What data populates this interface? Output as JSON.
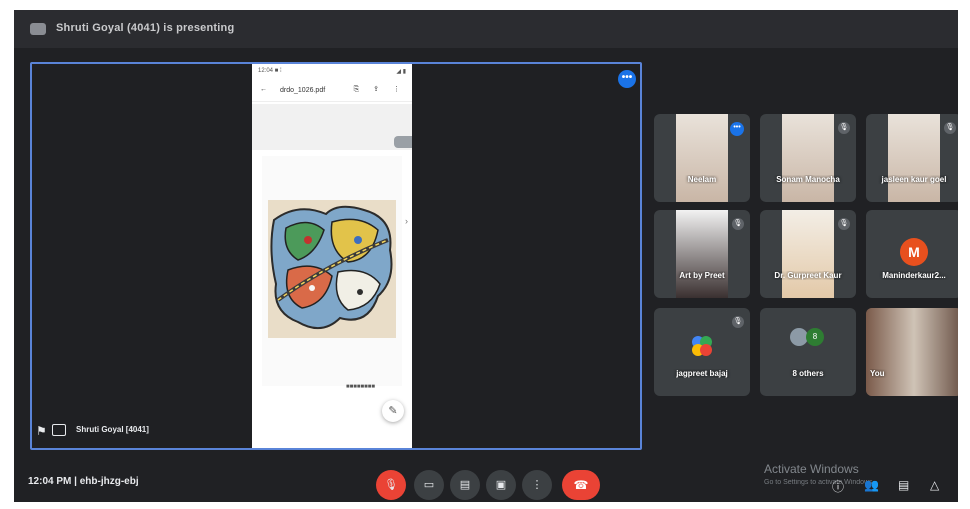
{
  "topbar": {
    "title": "Shruti Goyal (4041) is presenting"
  },
  "stage": {
    "presenter_name": "Shruti Goyal [4041]",
    "more_label": "•••",
    "phone": {
      "time": "12:04 ■ ⁞",
      "signal": "◢ ▮",
      "back": "←",
      "filename": "drdo_1026.pdf",
      "tools": "⎘ ⇪ ⋮",
      "chevron": "›",
      "page_foot": "■■■■■■■■",
      "fab": "✎"
    }
  },
  "participants": [
    {
      "name": "Neelam",
      "badge": "•••"
    },
    {
      "name": "Sonam Manocha",
      "badge": "🎙"
    },
    {
      "name": "jasleen kaur goel",
      "badge": "🎙"
    },
    {
      "name": "Art by Preet",
      "badge": "🎙"
    },
    {
      "name": "Dr. Gurpreet Kaur",
      "badge": "🎙"
    },
    {
      "name": "Maninderkaur2...",
      "avatar": "M"
    },
    {
      "name": "jagpreet bajaj",
      "badge": "🎙"
    },
    {
      "name": "8 others",
      "avatar": "8"
    },
    {
      "name": "You"
    }
  ],
  "bottombar": {
    "time_meet": "12:04 PM  |  ehb-jhzg-ebj",
    "controls": {
      "mic": "🎙",
      "camera": "▭",
      "captions": "▤",
      "present": "▣",
      "more": "⋮",
      "end": "☎"
    },
    "watermark_title": "Activate Windows",
    "watermark_sub": "Go to Settings to activate Windows.",
    "right": {
      "info": "ⓘ",
      "people": "👥",
      "chat": "▤",
      "activities": "△"
    }
  },
  "colors": {
    "background": "#202124",
    "accent": "#1a73e8",
    "end_call": "#ea4335",
    "avatar_m": "#e8501e"
  }
}
